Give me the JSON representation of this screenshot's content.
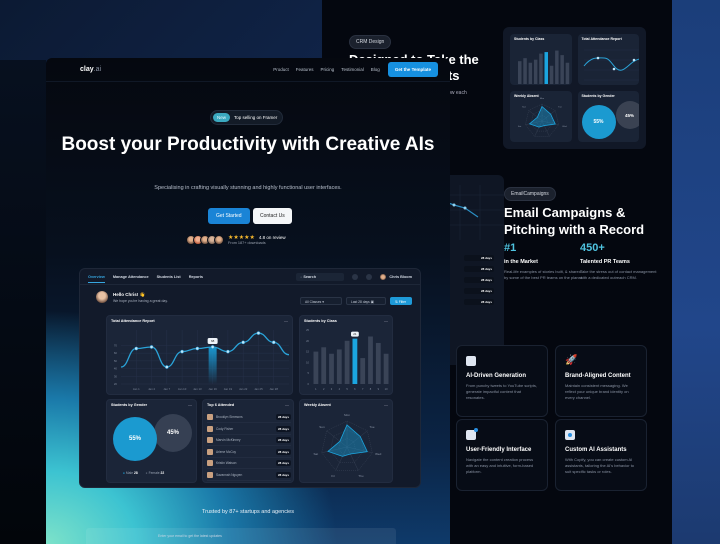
{
  "back_page": {
    "badge": "CRM Design",
    "title": "Designed to Take the Next Step Results",
    "subtitle": "…c see how each",
    "preview_cards": [
      "Students by Class",
      "Total Attendance Report",
      "Weekly Absent",
      "Students by Gender"
    ],
    "preview_gender": {
      "male": "55%",
      "female": "45%"
    },
    "email_section": {
      "badge": "EmailCampaigns",
      "title": "Email Campaigns & Pitching with a Record",
      "stats": [
        {
          "number": "#1",
          "label": "in the Market",
          "desc": "Real-life examples of stories built, & shared by some of the best PR teams on the planet."
        },
        {
          "number": "450+",
          "label": "Talented PR Teams",
          "desc": "Take the stress out of contact management with a dedicated outreach CRM."
        }
      ],
      "side_rows": [
        "28 days",
        "28 days",
        "28 days",
        "28 days",
        "28 days"
      ]
    },
    "features": [
      {
        "icon": "document-icon",
        "title": "AI-Driven Generation",
        "desc": "From punchy tweets to YouTube scripts, generate impactful content that resonates."
      },
      {
        "icon": "rocket-icon",
        "title": "Brand-Aligned Content",
        "desc": "Maintain consistent messaging. We reflect your unique brand identity on every channel."
      },
      {
        "icon": "chart-icon",
        "title": "User-Friendly Interface",
        "desc": "Navigate the content creation process with an easy and intuitive, form-based platform."
      },
      {
        "icon": "assistant-icon",
        "title": "Custom AI Assistants",
        "desc": "With Copify, you can create custom AI assistants, tailoring the AI's behavior to suit specific tasks or roles."
      }
    ]
  },
  "front_page": {
    "logo": "clay",
    "logo_suffix": ".ai",
    "nav": [
      "Product",
      "Features",
      "Pricing",
      "Testimonial",
      "Blog"
    ],
    "nav_cta": "Get the Template",
    "badge_new": "New",
    "badge_text": "Top selling on Framer",
    "hero_title": "Boost your Productivity with Creative AIs",
    "hero_subtitle": "Specialising in crafting visually stunning and highly functional user interfaces.",
    "btn_primary": "Get Started",
    "btn_secondary": "Contact Us",
    "rating_stars": 4.8,
    "rating_text": "4.8 on review",
    "rating_sub": "From 187+ downloads",
    "trusted": "Trusted by 87+ startups and agencies",
    "email_bar": "Enter your email to get the latest updates"
  },
  "dashboard": {
    "tabs": [
      "Overview",
      "Manage Attendance",
      "Students List",
      "Reports"
    ],
    "active_tab": 0,
    "search_placeholder": "Search",
    "user": "Chris Bloom",
    "greeting": "Hello Chris! 👋",
    "greeting_sub": "We hope you're having a great day.",
    "filter_class": "All Classes",
    "filter_date": "Last 28 days",
    "filter_btn": "Filter",
    "titles": {
      "line": "Total Attendance Report",
      "bar": "Students by Class",
      "gender": "Students by Gender",
      "top": "Top 6 Attended",
      "radar": "Weekly Absent"
    },
    "top6": [
      {
        "name": "Brooklyn Simmons",
        "days": "28 days"
      },
      {
        "name": "Cody Fisher",
        "days": "28 days"
      },
      {
        "name": "Marvin McKinney",
        "days": "28 days"
      },
      {
        "name": "Arlene McCoy",
        "days": "28 days"
      },
      {
        "name": "Kristin Watson",
        "days": "28 days"
      },
      {
        "name": "Savannah Nguyen",
        "days": "28 days"
      }
    ],
    "gender": {
      "male_pct": "55%",
      "female_pct": "45%",
      "male_label": "Male",
      "male_count": "28",
      "female_label": "Female",
      "female_count": "22"
    }
  },
  "chart_data": [
    {
      "type": "line",
      "title": "Total Attendance Report",
      "x": [
        "Jan 1",
        "Jan 4",
        "Jan 7",
        "Jan 10",
        "Jan 13",
        "Jan 16",
        "Jan 19",
        "Jan 22",
        "Jan 25",
        "Jan 28"
      ],
      "values": [
        42,
        66,
        68,
        42,
        62,
        66,
        68,
        62,
        74,
        86,
        74,
        58
      ],
      "x_full": [
        "start",
        "Jan 1",
        "Jan 4",
        "Jan 7",
        "Jan 10",
        "Jan 13",
        "Jan 16",
        "Jan 19",
        "Jan 22",
        "Jan 25",
        "Jan 28",
        "end"
      ],
      "yticks": [
        20,
        30,
        40,
        50,
        60,
        70
      ],
      "ylim": [
        20,
        90
      ],
      "highlight": "Jan 16",
      "highlight_label": "68"
    },
    {
      "type": "bar",
      "title": "Students by Class",
      "categories": [
        "1",
        "2",
        "3",
        "4",
        "5",
        "6",
        "7",
        "8",
        "9",
        "10"
      ],
      "values": [
        15,
        17,
        14,
        16,
        20,
        21,
        12,
        22,
        19,
        14
      ],
      "yticks": [
        0,
        5,
        10,
        15,
        20,
        25
      ],
      "ylim": [
        0,
        25
      ],
      "highlight": "6",
      "highlight_label": "21"
    },
    {
      "type": "pie",
      "title": "Students by Gender",
      "labels": [
        "Male",
        "Female"
      ],
      "values": [
        55,
        45
      ]
    },
    {
      "type": "radar",
      "title": "Weekly Absent",
      "axes": [
        "Mon",
        "Tue",
        "Wed",
        "Thu",
        "Fri",
        "Sat",
        "Sun"
      ],
      "values": [
        0.85,
        0.65,
        0.8,
        0.3,
        0.4,
        0.75,
        0.35
      ],
      "rmax": 1
    }
  ]
}
